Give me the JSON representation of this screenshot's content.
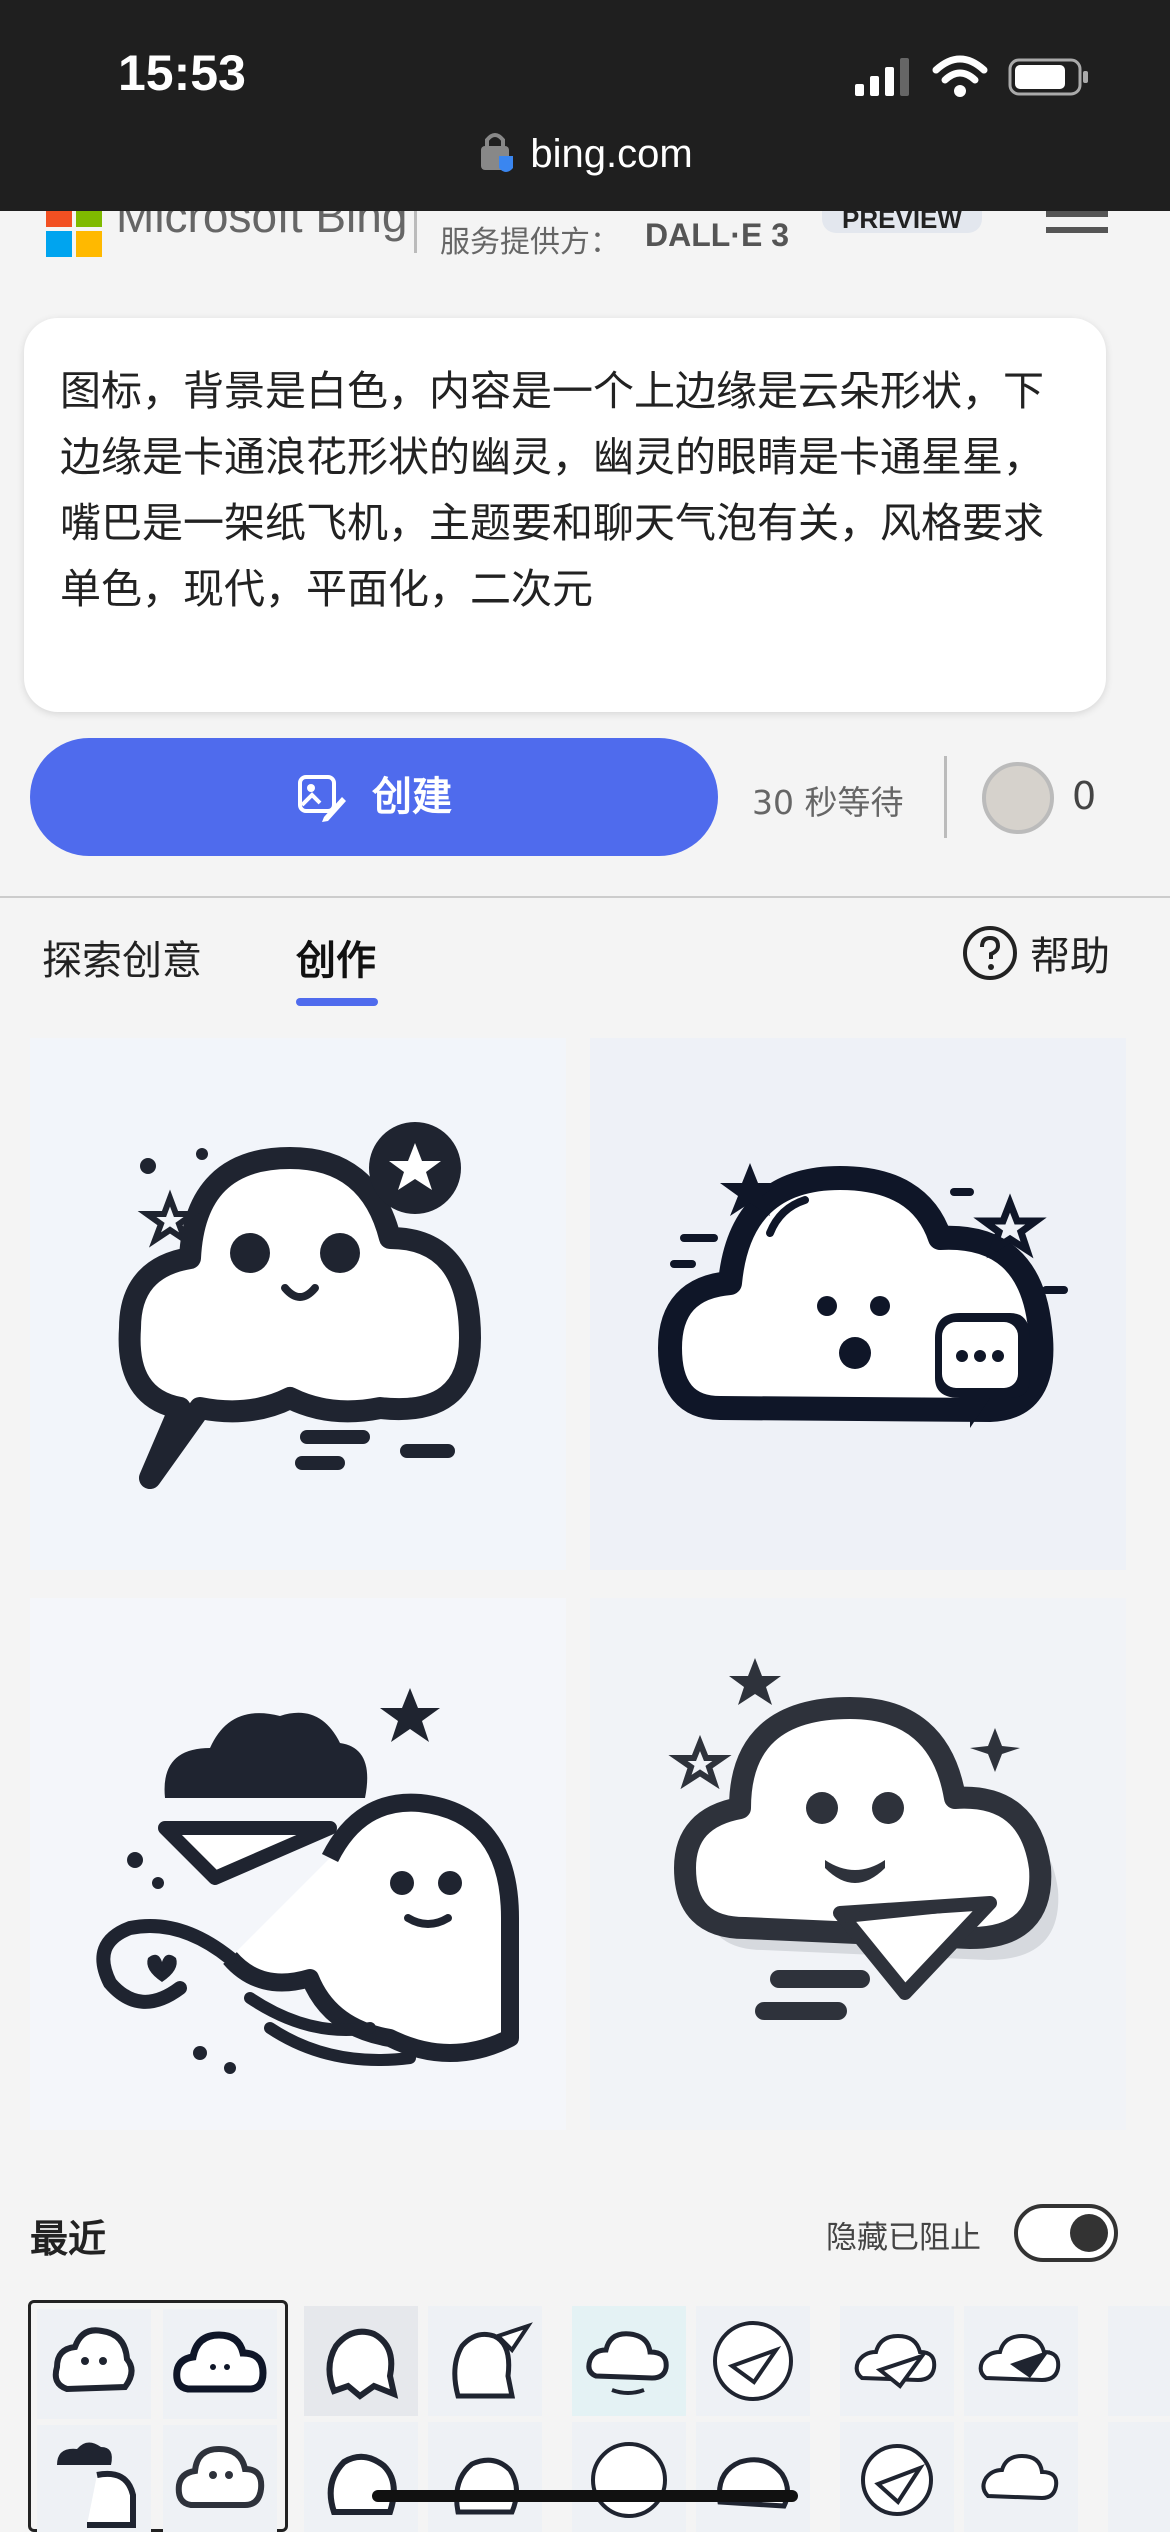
{
  "status_bar": {
    "time": "15:53",
    "url": "bing.com"
  },
  "header": {
    "brand": "Microsoft Bing",
    "provider_label": "服务提供方：",
    "provider": "DALL·E 3",
    "badge": "PREVIEW"
  },
  "prompt": {
    "text": "图标，背景是白色，内容是一个上边缘是云朵形状，下边缘是卡通浪花形状的幽灵，幽灵的眼睛是卡通星星，嘴巴是一架纸飞机，主题要和聊天气泡有关，风格要求单色，现代，平面化，二次元"
  },
  "create": {
    "button_label": "创建",
    "wait_text": "30 秒等待",
    "boost_count": "0"
  },
  "tabs": {
    "explore": "探索创意",
    "create": "创作",
    "help": "帮助"
  },
  "images": [
    {
      "icon": "ghost-cloud-speech-bubble"
    },
    {
      "icon": "cloud-face-chat-bubble"
    },
    {
      "icon": "ghost-paper-plane"
    },
    {
      "icon": "cloud-ghost-paper-plane"
    }
  ],
  "recent": {
    "title": "最近",
    "hide_blocked_label": "隐藏已阻止",
    "hide_blocked_on": true
  },
  "colors": {
    "accent": "#4f6bed",
    "icon_ink": "#1f2430"
  }
}
